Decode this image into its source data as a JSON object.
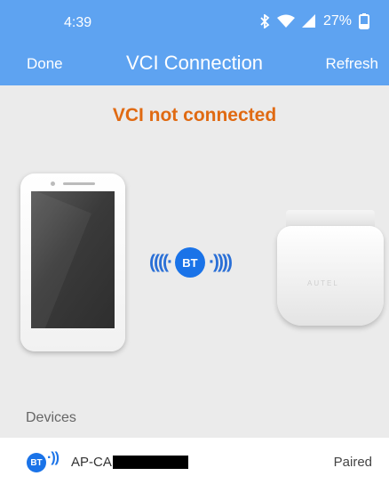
{
  "colors": {
    "brand": "#5ea3f1",
    "warning": "#e06a12"
  },
  "status_bar": {
    "time": "4:39",
    "battery_percent": "27%",
    "icons": [
      "bluetooth-icon",
      "wifi-icon",
      "signal-icon",
      "battery-icon"
    ]
  },
  "navbar": {
    "left_label": "Done",
    "title": "VCI Connection",
    "right_label": "Refresh"
  },
  "connection": {
    "status": "VCI not connected",
    "bt_badge": "BT",
    "left_waves": "((((·",
    "right_waves": "·))))"
  },
  "vci_device": {
    "brand": "AUTEL"
  },
  "devices": {
    "header": "Devices",
    "items": [
      {
        "badge": "BT",
        "name": "AP-CAP",
        "status": "Paired"
      }
    ]
  }
}
